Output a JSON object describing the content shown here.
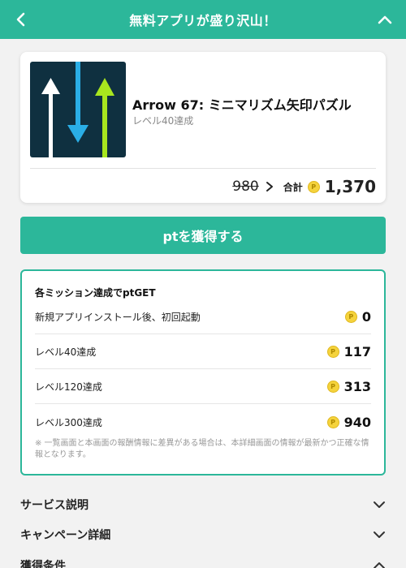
{
  "header": {
    "title": "無料アプリが盛り沢山！"
  },
  "app": {
    "name": "Arrow 67: ミニマリズム矢印パズル",
    "subtitle": "レベル40達成",
    "old_points": "980",
    "total_label": "合計",
    "total_points": "1,370",
    "icon_colors": [
      "#ffffff",
      "#2aaee6",
      "#a8e61e"
    ]
  },
  "get_button": {
    "label": "ptを獲得する"
  },
  "missions": {
    "title": "各ミッション達成でptGET",
    "items": [
      {
        "label": "新規アプリインストール後、初回起動",
        "points": "0"
      },
      {
        "label": "レベル40達成",
        "points": "117"
      },
      {
        "label": "レベル120達成",
        "points": "313"
      },
      {
        "label": "レベル300達成",
        "points": "940"
      }
    ],
    "note": "※ 一覧画面と本画面の報酬情報に差異がある場合は、本詳細画面の情報が最新かつ正確な情報となります。"
  },
  "sections": [
    {
      "label": "サービス説明",
      "state": "collapsed"
    },
    {
      "label": "キャンペーン詳細",
      "state": "collapsed"
    },
    {
      "label": "獲得条件",
      "state": "expanded"
    }
  ],
  "colors": {
    "brand": "#2cb79a",
    "coin": "#f5d33c",
    "background": "#f2f2f2"
  }
}
